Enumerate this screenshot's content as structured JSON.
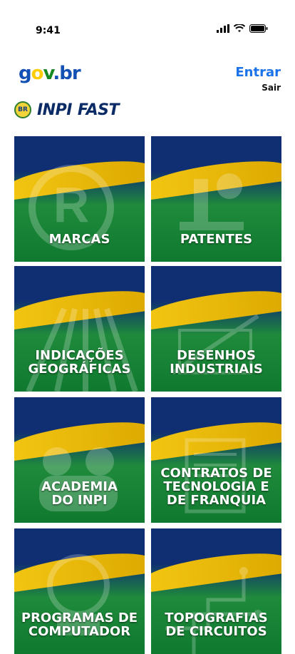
{
  "status": {
    "time": "9:41",
    "icons": [
      "signal-icon",
      "wifi-icon",
      "battery-icon"
    ]
  },
  "header": {
    "logo_parts": [
      "g",
      "o",
      "v",
      ".br"
    ],
    "login_label": "Entrar",
    "logout_label": "Sair"
  },
  "brand": {
    "badge": "BR",
    "inpi": "INPI",
    "fast": "FAST"
  },
  "tiles": [
    {
      "label": "MARCAS",
      "icon": "registered-trademark-icon"
    },
    {
      "label": "PATENTES",
      "icon": "microscope-icon"
    },
    {
      "label": "INDICAÇÕES\nGEOGRÁFICAS",
      "icon": "vineyard-icon"
    },
    {
      "label": "DESENHOS\nINDUSTRIAIS",
      "icon": "drafting-icon"
    },
    {
      "label": "ACADEMIA\nDO INPI",
      "icon": "student-icon"
    },
    {
      "label": "CONTRATOS DE\nTECNOLOGIA E\nDE FRANQUIA",
      "icon": "contract-icon"
    },
    {
      "label": "PROGRAMAS DE\nCOMPUTADOR",
      "icon": "computer-icon"
    },
    {
      "label": "TOPOGRAFIAS\nDE CIRCUITOS",
      "icon": "circuit-icon"
    }
  ],
  "colors": {
    "navy": "#102f72",
    "green": "#1f8a3b",
    "yellow": "#f3c613",
    "link": "#1a73e8"
  }
}
